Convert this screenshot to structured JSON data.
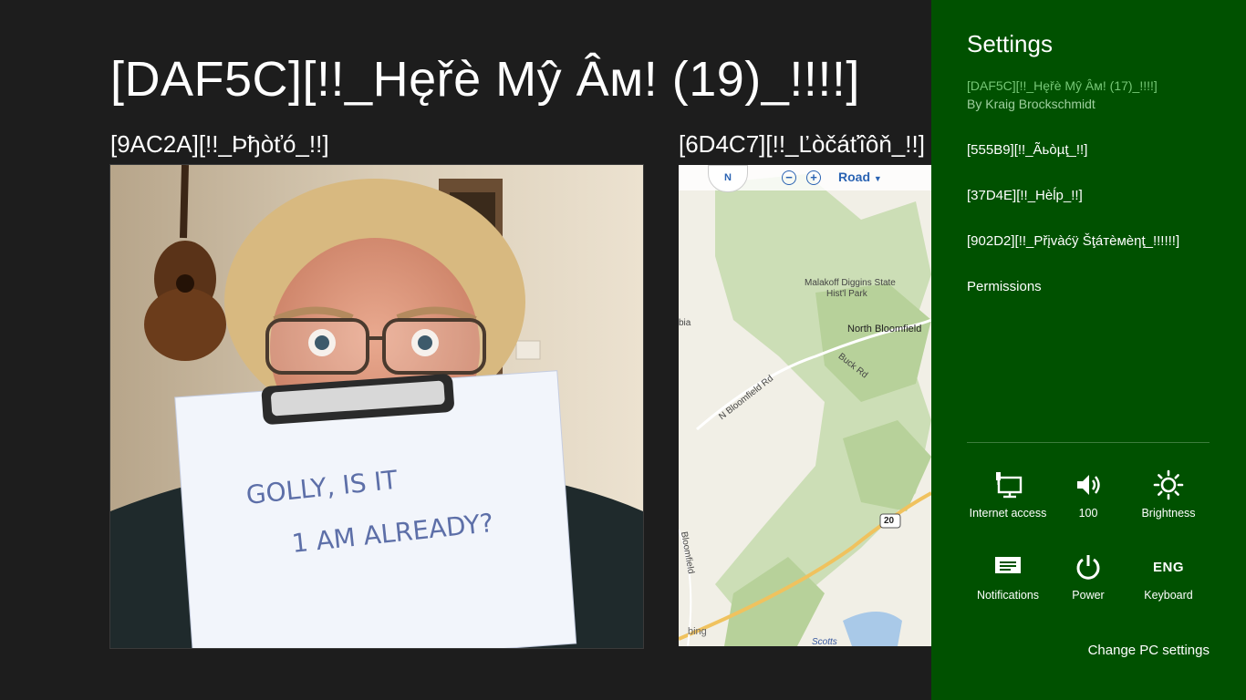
{
  "app": {
    "title": "[DAF5C][!!_Hęřè Mŷ Âм! (19)_!!!!]"
  },
  "sections": {
    "photo_title": "[9AC2A][!!_Þђòťó_!!]",
    "location_title": "[6D4C7][!!_Ľòčáťîôň_!!]"
  },
  "photo": {
    "sign_line1": "GOLLY, IS IT",
    "sign_line2": "1 AM ALREADY?"
  },
  "map": {
    "compass_label": "N",
    "style_label": "Road",
    "labels": {
      "park1": "Malakoff Diggins State",
      "park2": "Hist'l Park",
      "town": "North Bloomfield",
      "road1": "N Bloomfield Rd",
      "road2": "Buck Rd",
      "road3": "Bloomfield",
      "left_edge": "bia",
      "highway": "20",
      "bottom": "Scotts",
      "brand": "bing"
    }
  },
  "settings": {
    "title": "Settings",
    "app_name": "[DAF5C][!!_Hęřè Mŷ Âм! (17)_!!!!]",
    "author": "By Kraig Brockschmidt",
    "menu": [
      {
        "label": "[555B9][!!_Ãьòµţ_!!]"
      },
      {
        "label": "[37D4E][!!_Hèĺp_!!]"
      },
      {
        "label": "[902D2][!!_Přįvàćÿ  Šţáтèмèηţ_!!!!!!]"
      },
      {
        "label": "Permissions"
      }
    ],
    "tiles": {
      "internet": {
        "label": "Internet access",
        "icon": "network-icon"
      },
      "volume": {
        "label": "100",
        "icon": "volume-icon"
      },
      "brightness": {
        "label": "Brightness",
        "icon": "brightness-icon"
      },
      "notifications": {
        "label": "Notifications",
        "icon": "notifications-icon"
      },
      "power": {
        "label": "Power",
        "icon": "power-icon"
      },
      "keyboard": {
        "label": "Keyboard",
        "glyph": "ENG"
      }
    },
    "change_pc_settings": "Change PC settings"
  },
  "colors": {
    "background": "#1d1d1d",
    "settings_pane": "#005100",
    "accent_text": "#76c776"
  }
}
